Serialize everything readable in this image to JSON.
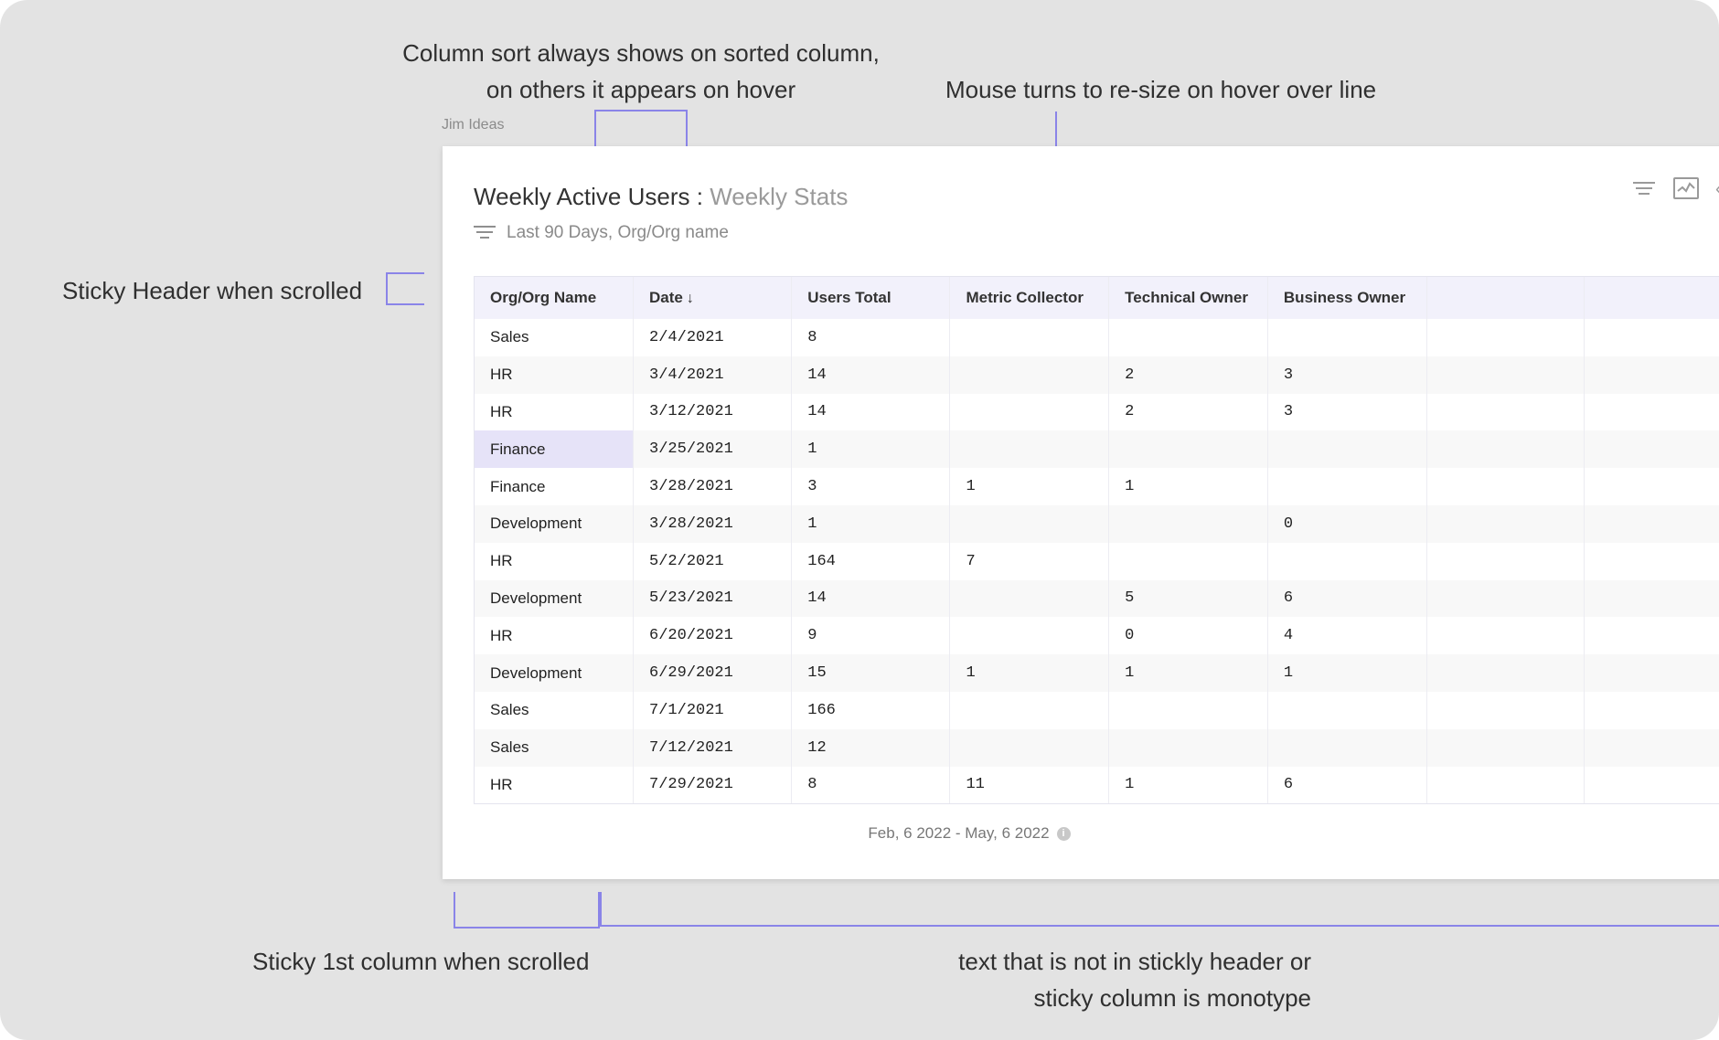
{
  "annotations": {
    "sort_line1": "Column sort always shows on sorted column,",
    "sort_line2": "on others it appears on hover",
    "resize": "Mouse turns to re-size on hover over line",
    "sticky_header": "Sticky Header when scrolled",
    "sticky_column": "Sticky 1st column when scrolled",
    "mono_line1": "text that is not in stickly header or",
    "mono_line2": "sticky column is monotype"
  },
  "workspace_label": "Jim Ideas",
  "card": {
    "title": "Weekly Active Users",
    "separator": ":",
    "subtitle": "Weekly Stats",
    "filter_text": "Last 90 Days, Org/Org name",
    "date_range": "Feb, 6 2022 - May, 6 2022"
  },
  "icons": {
    "filter": "filter-icon",
    "chart": "line-chart-icon",
    "more": "more-icon",
    "info": "info-icon",
    "sort": "arrow-down-icon"
  },
  "colors": {
    "accent": "#8a84e8",
    "header_bg": "#f2f1fb",
    "selected_cell": "#e6e3f8"
  },
  "table": {
    "columns": [
      "Org/Org Name",
      "Date",
      "Users Total",
      "Metric Collector",
      "Technical Owner",
      "Business Owner",
      "",
      ""
    ],
    "sort_indicator": "↓",
    "rows": [
      [
        "Sales",
        "2/4/2021",
        "8",
        "",
        "",
        "",
        "",
        ""
      ],
      [
        "HR",
        "3/4/2021",
        "14",
        "",
        "2",
        "3",
        "",
        ""
      ],
      [
        "HR",
        "3/12/2021",
        "14",
        "",
        "2",
        "3",
        "",
        ""
      ],
      [
        "Finance",
        "3/25/2021",
        "1",
        "",
        "",
        "",
        "",
        ""
      ],
      [
        "Finance",
        "3/28/2021",
        "3",
        "1",
        "1",
        "",
        "",
        ""
      ],
      [
        "Development",
        "3/28/2021",
        "1",
        "",
        "",
        "0",
        "",
        ""
      ],
      [
        "HR",
        "5/2/2021",
        "164",
        "7",
        "",
        "",
        "",
        ""
      ],
      [
        "Development",
        "5/23/2021",
        "14",
        "",
        "5",
        "6",
        "",
        ""
      ],
      [
        "HR",
        "6/20/2021",
        "9",
        "",
        "0",
        "4",
        "",
        ""
      ],
      [
        "Development",
        "6/29/2021",
        "15",
        "1",
        "1",
        "1",
        "",
        ""
      ],
      [
        "Sales",
        "7/1/2021",
        "166",
        "",
        "",
        "",
        "",
        ""
      ],
      [
        "Sales",
        "7/12/2021",
        "12",
        "",
        "",
        "",
        "",
        ""
      ],
      [
        "HR",
        "7/29/2021",
        "8",
        "11",
        "1",
        "6",
        "",
        ""
      ]
    ]
  }
}
